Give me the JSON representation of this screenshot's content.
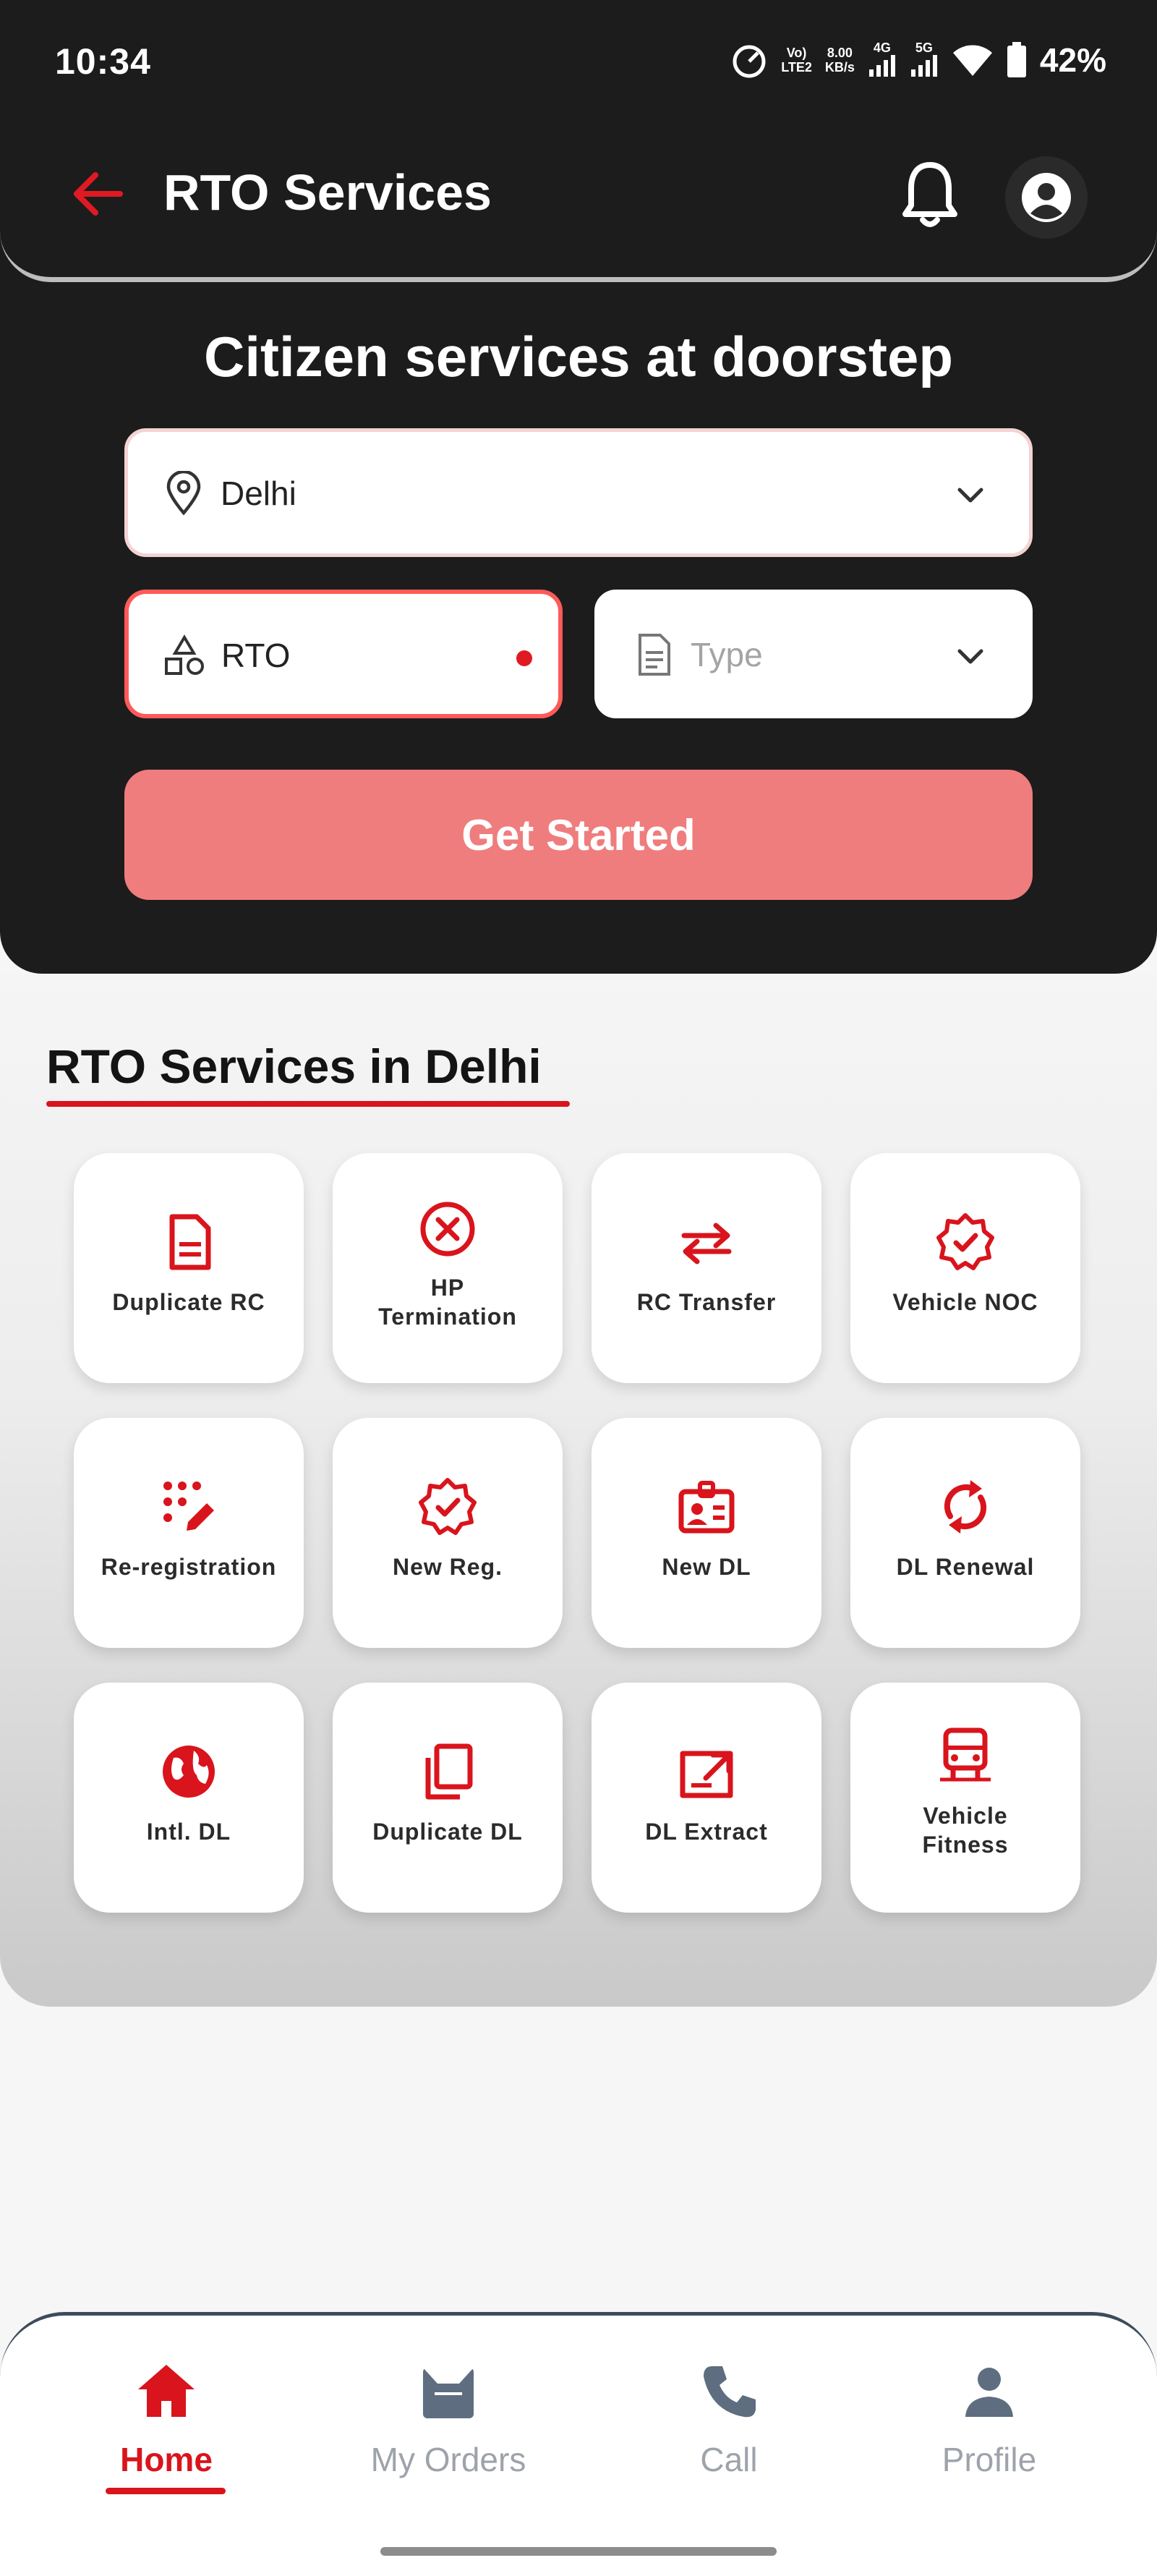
{
  "status_bar": {
    "time": "10:34",
    "volte_top": "Vo)",
    "volte_bottom": "LTE2",
    "speed_top": "8.00",
    "speed_bottom": "KB/s",
    "net1": "4G",
    "net2": "5G",
    "battery": "42%"
  },
  "app_bar": {
    "title": "RTO Services"
  },
  "hero": {
    "title": "Citizen services at doorstep",
    "city_value": "Delhi",
    "office_value": "RTO",
    "type_placeholder": "Type",
    "cta_label": "Get Started"
  },
  "services": {
    "title": "RTO Services in Delhi",
    "items": [
      {
        "line1": "Duplicate RC",
        "line2": "",
        "icon": "document-icon"
      },
      {
        "line1": "HP",
        "line2": "Termination",
        "icon": "cancel-circle-icon"
      },
      {
        "line1": "RC Transfer",
        "line2": "",
        "icon": "transfer-arrows-icon"
      },
      {
        "line1": "Vehicle NOC",
        "line2": "",
        "icon": "verified-badge-icon"
      },
      {
        "line1": "Re-registration",
        "line2": "",
        "icon": "dots-pencil-icon"
      },
      {
        "line1": "New Reg.",
        "line2": "",
        "icon": "verified-badge-icon"
      },
      {
        "line1": "New DL",
        "line2": "",
        "icon": "id-card-icon"
      },
      {
        "line1": "DL Renewal",
        "line2": "",
        "icon": "refresh-icon"
      },
      {
        "line1": "Intl. DL",
        "line2": "",
        "icon": "globe-icon"
      },
      {
        "line1": "Duplicate DL",
        "line2": "",
        "icon": "copy-icon"
      },
      {
        "line1": "DL Extract",
        "line2": "",
        "icon": "extract-icon"
      },
      {
        "line1": "Vehicle",
        "line2": "Fitness",
        "icon": "vehicle-icon"
      }
    ]
  },
  "bottom_nav": {
    "items": [
      {
        "label": "Home",
        "icon": "home-icon",
        "active": true
      },
      {
        "label": "My Orders",
        "icon": "orders-icon",
        "active": false
      },
      {
        "label": "Call",
        "icon": "phone-icon",
        "active": false
      },
      {
        "label": "Profile",
        "icon": "profile-icon",
        "active": false
      }
    ]
  },
  "colors": {
    "accent": "#d9141c",
    "header_bg": "#1c1c1c",
    "cta_bg": "#ef7d7e",
    "inactive_nav": "#9ea3ab"
  }
}
